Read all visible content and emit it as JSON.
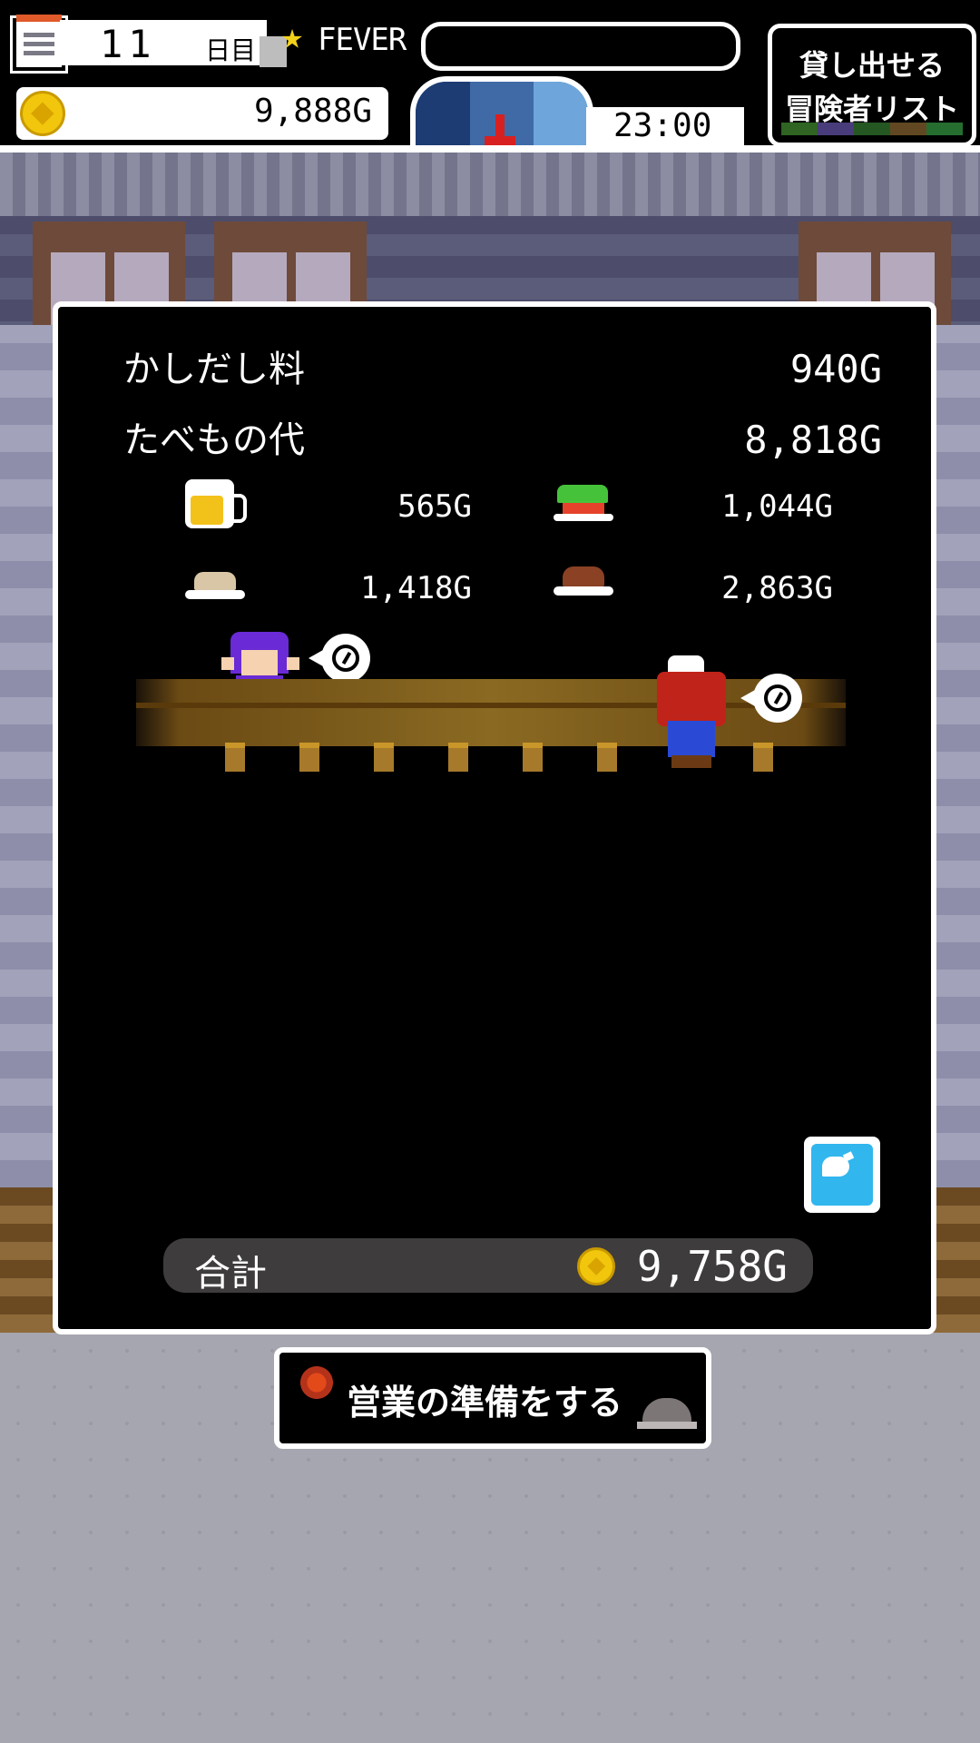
{
  "hud": {
    "day_number": "11",
    "day_unit": "日目",
    "fever_label": "FEVER",
    "fever_level": 0,
    "gold": "9,888G",
    "time": "23:00",
    "list_button_line1": "貸し出せる",
    "list_button_line2": "冒険者リスト"
  },
  "panel": {
    "rental_fee_label": "かしだし料",
    "rental_fee_value": "940G",
    "food_label": "たべもの代",
    "food_value": "8,818G",
    "items": [
      {
        "icon": "beer-icon",
        "value": "565G"
      },
      {
        "icon": "salad-icon",
        "value": "1,044G"
      },
      {
        "icon": "rice-plate-icon",
        "value": "1,418G"
      },
      {
        "icon": "meat-plate-icon",
        "value": "2,863G"
      }
    ],
    "total_label": "合計",
    "total_value": "9,758G"
  },
  "prepare_button_label": "営業の準備をする",
  "colors": {
    "panel_bg": "#000000",
    "gold_coin": "#f1c60c",
    "share_button": "#31b6ee",
    "fever_star": "#f2d11a"
  }
}
